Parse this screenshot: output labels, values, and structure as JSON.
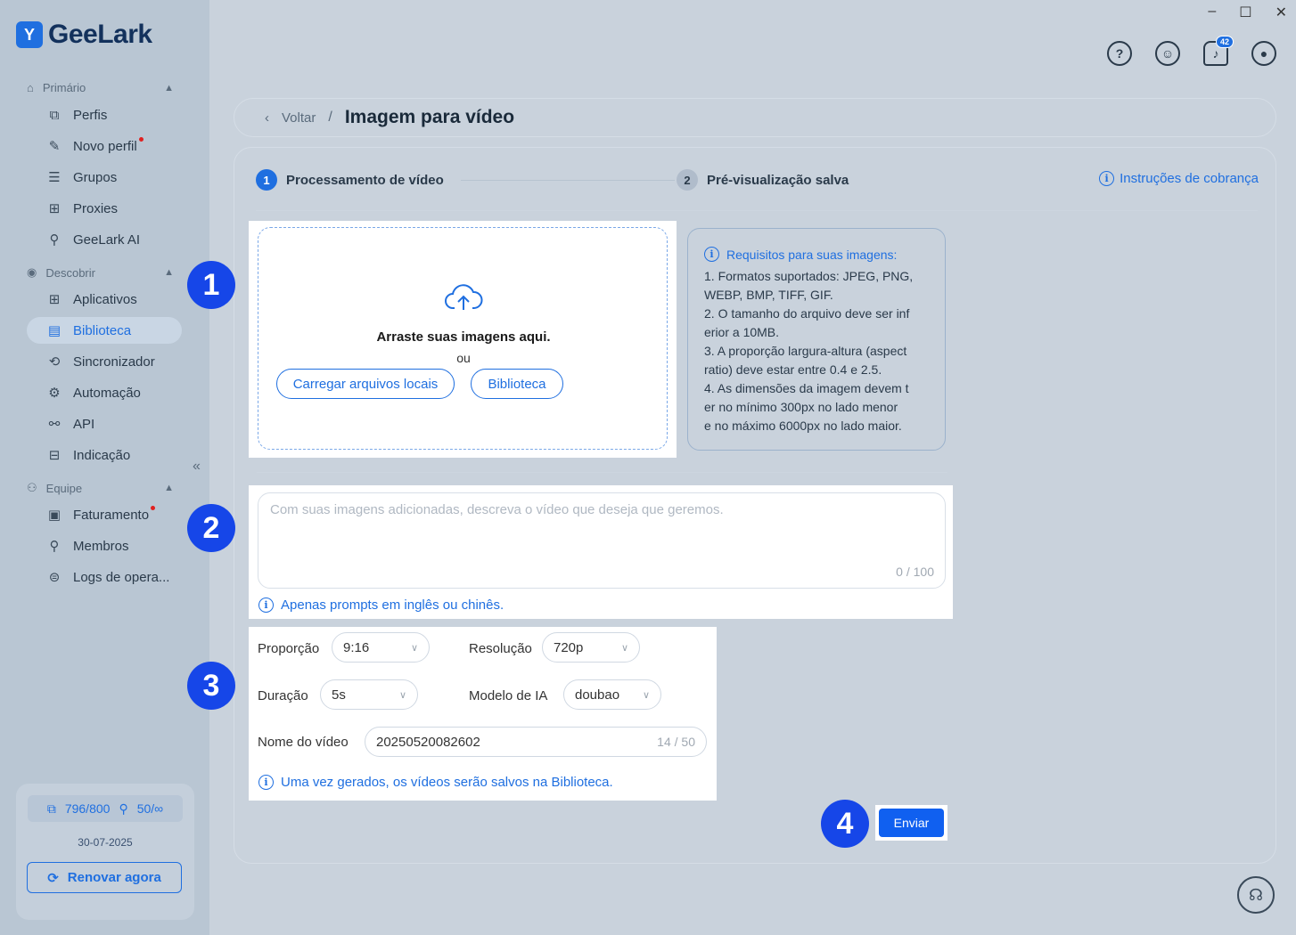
{
  "app": {
    "name": "GeeLark"
  },
  "window_controls": {
    "minimize": "–",
    "maximize": "☐",
    "close": "✕"
  },
  "top_icons": {
    "notifications_badge": "42"
  },
  "sidebar": {
    "sections": [
      {
        "label": "Primário"
      },
      {
        "label": "Descobrir"
      },
      {
        "label": "Equipe"
      }
    ],
    "items": [
      {
        "label": "Perfis"
      },
      {
        "label": "Novo perfil"
      },
      {
        "label": "Grupos"
      },
      {
        "label": "Proxies"
      },
      {
        "label": "GeeLark AI"
      },
      {
        "label": "Aplicativos"
      },
      {
        "label": "Biblioteca"
      },
      {
        "label": "Sincronizador"
      },
      {
        "label": "Automação"
      },
      {
        "label": "API"
      },
      {
        "label": "Indicação"
      },
      {
        "label": "Faturamento"
      },
      {
        "label": "Membros"
      },
      {
        "label": "Logs de opera..."
      }
    ],
    "account": {
      "profiles": "796/800",
      "members": "50/∞",
      "date": "30-07-2025",
      "renew_label": "Renovar agora"
    }
  },
  "breadcrumb": {
    "back": "Voltar",
    "separator": "/",
    "title": "Imagem para vídeo"
  },
  "steps": [
    {
      "num": "1",
      "label": "Processamento de vídeo"
    },
    {
      "num": "2",
      "label": "Pré-visualização salva"
    }
  ],
  "billing_link": "Instruções de cobrança",
  "upload": {
    "title": "Arraste suas imagens aqui.",
    "or": "ou",
    "local_button": "Carregar arquivos locais",
    "library_button": "Biblioteca"
  },
  "requirements": {
    "title": "Requisitos para suas imagens:",
    "lines": [
      "1. Formatos suportados: JPEG, PNG,",
      "WEBP, BMP, TIFF, GIF.",
      "2. O tamanho do arquivo deve ser inf",
      "erior a 10MB.",
      "3. A proporção largura-altura (aspect",
      "ratio) deve estar entre 0.4 e 2.5.",
      "4. As dimensões da imagem devem t",
      "er no mínimo 300px no lado menor",
      "e no máximo 6000px no lado maior."
    ]
  },
  "prompt": {
    "placeholder": "Com suas imagens adicionadas, descreva o vídeo que deseja que geremos.",
    "count": "0 / 100",
    "hint": "Apenas prompts em inglês ou chinês."
  },
  "settings": {
    "ratio_label": "Proporção",
    "ratio_value": "9:16",
    "resolution_label": "Resolução",
    "resolution_value": "720p",
    "duration_label": "Duração",
    "duration_value": "5s",
    "model_label": "Modelo de IA",
    "model_value": "doubao",
    "name_label": "Nome do vídeo",
    "name_value": "20250520082602",
    "name_count": "14 / 50",
    "hint": "Uma vez gerados, os vídeos serão salvos na Biblioteca."
  },
  "annotations": [
    "1",
    "2",
    "3",
    "4"
  ],
  "submit_label": "Enviar",
  "colors": {
    "accent": "#1f6fe0",
    "annotation": "#1646e8",
    "sidebar_bg": "#b9c6d3",
    "content_bg": "#c9d2dc"
  }
}
